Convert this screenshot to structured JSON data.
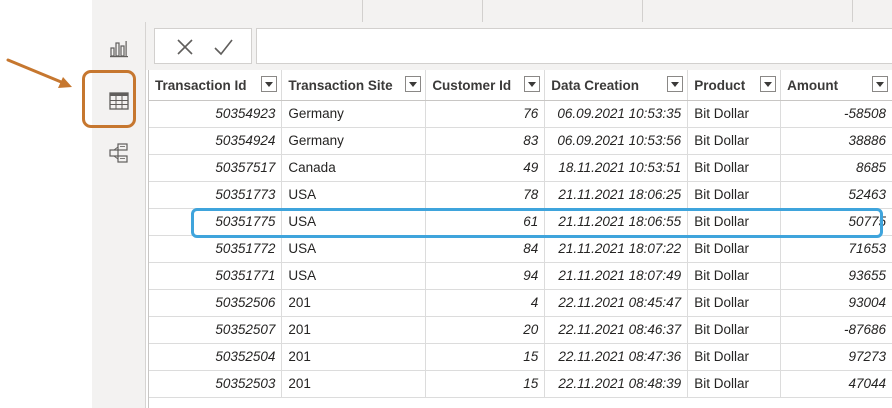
{
  "nav": {
    "items": [
      {
        "name": "report-view-icon"
      },
      {
        "name": "data-view-icon",
        "active": true
      },
      {
        "name": "model-view-icon"
      }
    ]
  },
  "formula_bar": {
    "cancel_icon": "close-icon",
    "commit_icon": "checkmark-icon",
    "value": ""
  },
  "table": {
    "columns": [
      "Transaction Id",
      "Transaction Site",
      "Customer Id",
      "Data Creation",
      "Product",
      "Amount"
    ],
    "rows": [
      [
        "50354923",
        "Germany",
        "76",
        "06.09.2021 10:53:35",
        "Bit Dollar",
        "-58508"
      ],
      [
        "50354924",
        "Germany",
        "83",
        "06.09.2021 10:53:56",
        "Bit Dollar",
        "38886"
      ],
      [
        "50357517",
        "Canada",
        "49",
        "18.11.2021 10:53:51",
        "Bit Dollar",
        "8685"
      ],
      [
        "50351773",
        "USA",
        "78",
        "21.11.2021 18:06:25",
        "Bit Dollar",
        "52463"
      ],
      [
        "50351775",
        "USA",
        "61",
        "21.11.2021 18:06:55",
        "Bit Dollar",
        "50775"
      ],
      [
        "50351772",
        "USA",
        "84",
        "21.11.2021 18:07:22",
        "Bit Dollar",
        "71653"
      ],
      [
        "50351771",
        "USA",
        "94",
        "21.11.2021 18:07:49",
        "Bit Dollar",
        "93655"
      ],
      [
        "50352506",
        "201",
        "4",
        "22.11.2021 08:45:47",
        "Bit Dollar",
        "93004"
      ],
      [
        "50352507",
        "201",
        "20",
        "22.11.2021 08:46:37",
        "Bit Dollar",
        "-87686"
      ],
      [
        "50352504",
        "201",
        "15",
        "22.11.2021 08:47:36",
        "Bit Dollar",
        "97273"
      ],
      [
        "50352503",
        "201",
        "15",
        "22.11.2021 08:48:39",
        "Bit Dollar",
        "47044"
      ]
    ],
    "highlighted_row": 4
  },
  "colors": {
    "annotation_orange": "#c6772f",
    "annotation_blue": "#3fa4dc"
  }
}
